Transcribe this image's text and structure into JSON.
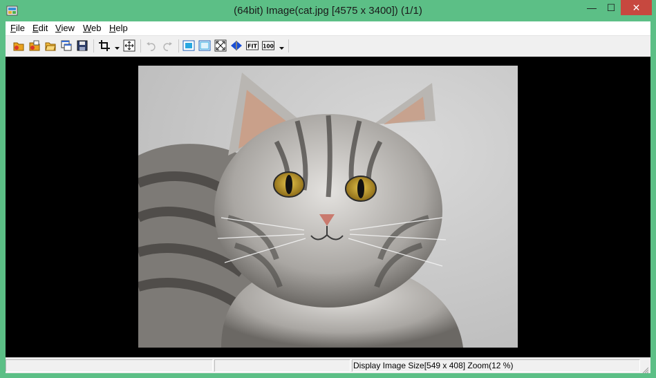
{
  "window": {
    "title": "(64bit) Image(cat.jpg [4575 x 3400]) (1/1)",
    "accent_color": "#5cbf86",
    "close_color": "#c7483f",
    "controls": {
      "minimize": "—",
      "maximize": "☐",
      "close": "✕"
    }
  },
  "menu": {
    "items": [
      {
        "label": "File"
      },
      {
        "label": "Edit"
      },
      {
        "label": "View"
      },
      {
        "label": "Web"
      },
      {
        "label": "Help"
      }
    ]
  },
  "toolbar": {
    "buttons": [
      "open-icon",
      "open-folder-icon",
      "browse-folder-icon",
      "new-window-icon",
      "save-icon",
      "crop-icon",
      "crop-dropdown-icon",
      "move-icon",
      "undo-icon",
      "redo-icon",
      "fit-window-icon",
      "fit-frame-icon",
      "fullscreen-icon",
      "mirror-icon",
      "fit-icon",
      "actual-size-icon",
      "zoom-dropdown-icon"
    ],
    "fit_label": "FIT",
    "actual_size_label": "100"
  },
  "image": {
    "file_name": "cat.jpg",
    "content": "photograph of a tabby kitten"
  },
  "status": {
    "text": "Display Image Size[549 x 408]  Zoom(12 %)"
  }
}
